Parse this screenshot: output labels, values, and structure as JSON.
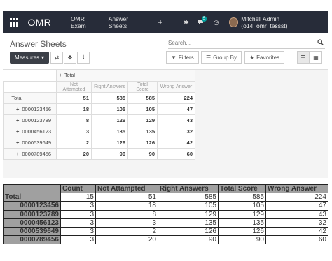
{
  "navbar": {
    "brand": "OMR",
    "menu": [
      "OMR Exam",
      "Answer Sheets"
    ],
    "plus": "+",
    "bug_icon": "✱",
    "chat_count": "5",
    "clock_icon": "◷",
    "user": "Mitchell Admin (o14_omr_tessst)"
  },
  "control": {
    "breadcrumb": "Answer Sheets",
    "search_placeholder": "Search...",
    "measures_label": "Measures",
    "filters_label": "Filters",
    "groupby_label": "Group By",
    "favorites_label": "Favorites"
  },
  "pivot": {
    "col_total": "Total",
    "headers": [
      "Not Attampted",
      "Right Answers",
      "Total Score",
      "Wrong Answer"
    ],
    "rows": [
      {
        "label": "Total",
        "expanded": true,
        "values": [
          "51",
          "585",
          "585",
          "224"
        ]
      },
      {
        "label": "0000123456",
        "values": [
          "18",
          "105",
          "105",
          "47"
        ]
      },
      {
        "label": "0000123789",
        "values": [
          "8",
          "129",
          "129",
          "43"
        ]
      },
      {
        "label": "0000456123",
        "values": [
          "3",
          "135",
          "135",
          "32"
        ]
      },
      {
        "label": "0000539649",
        "values": [
          "2",
          "126",
          "126",
          "42"
        ]
      },
      {
        "label": "0000789456",
        "values": [
          "20",
          "90",
          "90",
          "60"
        ]
      }
    ]
  },
  "table": {
    "headers": [
      "",
      "Count",
      "Not Attampted",
      "Right Answers",
      "Total Score",
      "Wrong Answer"
    ],
    "rows": [
      [
        "Total",
        "15",
        "51",
        "585",
        "585",
        "224"
      ],
      [
        "0000123456",
        "3",
        "18",
        "105",
        "105",
        "47"
      ],
      [
        "0000123789",
        "3",
        "8",
        "129",
        "129",
        "43"
      ],
      [
        "0000456123",
        "3",
        "3",
        "135",
        "135",
        "32"
      ],
      [
        "0000539649",
        "3",
        "2",
        "126",
        "126",
        "42"
      ],
      [
        "0000789456",
        "3",
        "20",
        "90",
        "90",
        "60"
      ]
    ]
  },
  "colors": {
    "navbar_bg": "#272c39",
    "measures_bg": "#3b3f47",
    "chat_badge": "#00a09d",
    "table_header_bg": "#a0a0a0"
  }
}
